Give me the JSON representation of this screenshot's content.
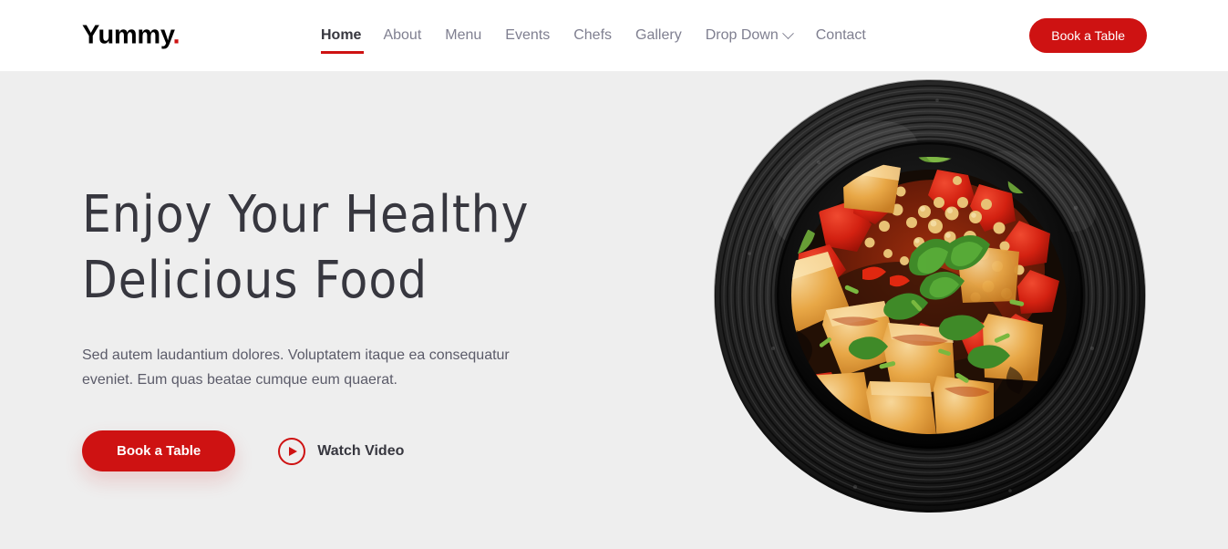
{
  "brand": {
    "name": "Yummy",
    "dot": "."
  },
  "nav": {
    "items": [
      {
        "label": "Home",
        "active": true,
        "has_dropdown": false
      },
      {
        "label": "About",
        "active": false,
        "has_dropdown": false
      },
      {
        "label": "Menu",
        "active": false,
        "has_dropdown": false
      },
      {
        "label": "Events",
        "active": false,
        "has_dropdown": false
      },
      {
        "label": "Chefs",
        "active": false,
        "has_dropdown": false
      },
      {
        "label": "Gallery",
        "active": false,
        "has_dropdown": false
      },
      {
        "label": "Drop Down",
        "active": false,
        "has_dropdown": true
      },
      {
        "label": "Contact",
        "active": false,
        "has_dropdown": false
      }
    ]
  },
  "header": {
    "cta_label": "Book a Table"
  },
  "hero": {
    "title_line1": "Enjoy Your Healthy",
    "title_line2": "Delicious Food",
    "description": "Sed autem laudantium dolores. Voluptatem itaque ea consequatur eveniet. Eum quas beatae cumque eum quaerat.",
    "primary_cta": "Book a Table",
    "video_label": "Watch Video",
    "image_alt": "Black ribbed plate with fried tofu cubes, red bell peppers, crushed peanuts, cilantro and mint"
  },
  "colors": {
    "accent_red": "#ce1212",
    "heading_dark": "#37373f",
    "nav_gray": "#7f7f90",
    "hero_background": "#eeeeee",
    "header_background": "#ffffff",
    "body_text": "#5b5b69"
  },
  "icons": {
    "chevron_down": "chevron-down-icon",
    "play": "play-icon"
  }
}
